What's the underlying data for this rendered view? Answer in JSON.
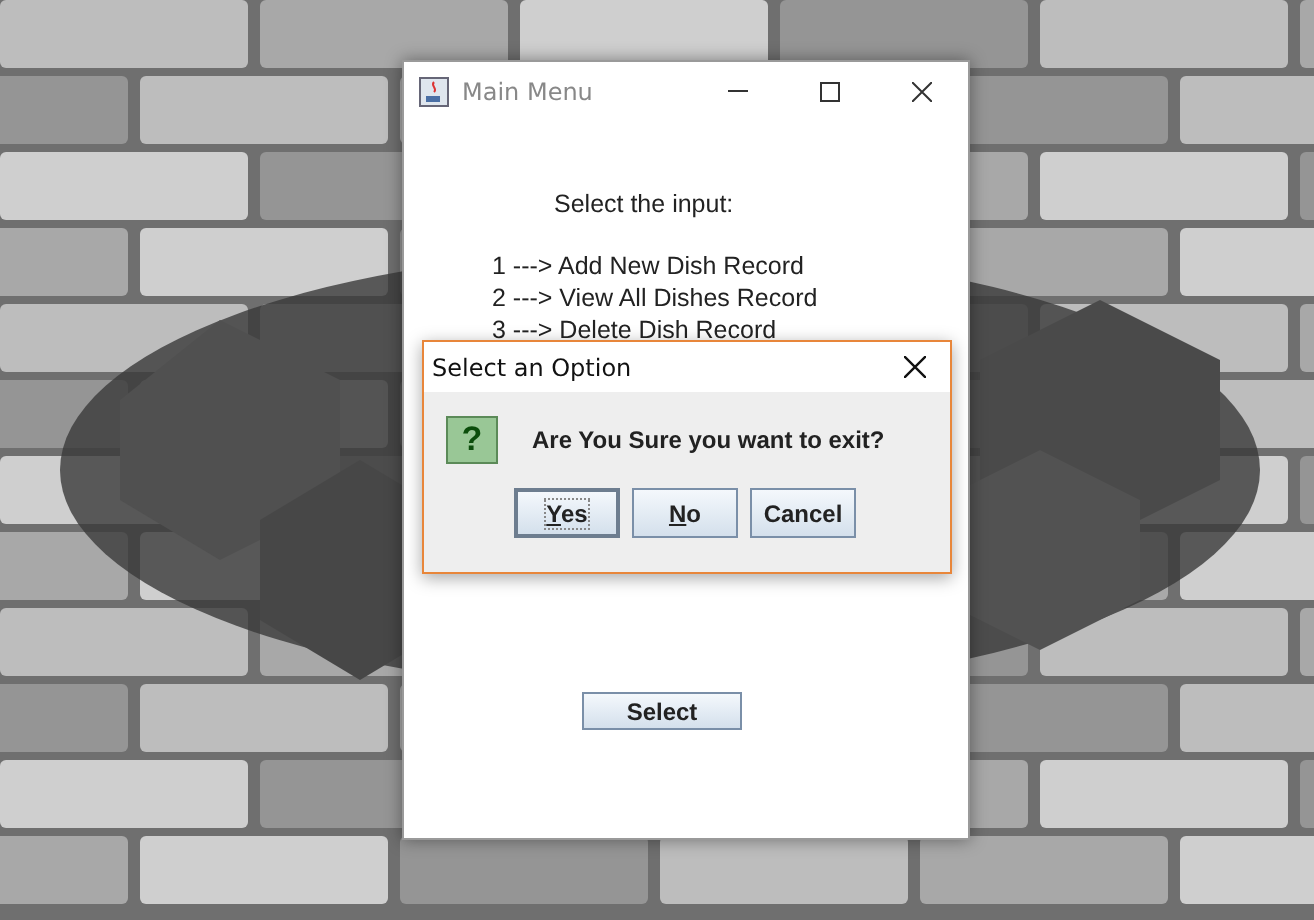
{
  "main_window": {
    "title": "Main Menu",
    "prompt": "Select the input:",
    "options": [
      "1 ---> Add New Dish Record",
      "2 ---> View All Dishes Record",
      "3 ---> Delete Dish Record"
    ],
    "button": "Select"
  },
  "dialog": {
    "title": "Select an Option",
    "message": "Are You Sure you want to exit?",
    "icon_glyph": "?",
    "buttons": [
      {
        "label": "Yes",
        "underline_first": true,
        "selected": true
      },
      {
        "label": "No",
        "underline_first": true,
        "selected": false
      },
      {
        "label": "Cancel",
        "underline_first": false,
        "selected": false
      }
    ]
  }
}
